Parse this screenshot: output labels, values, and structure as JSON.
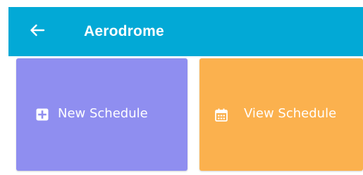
{
  "app_bar": {
    "title": "Aerodrome",
    "back_icon": "arrow-left-icon",
    "background_color": "#02a9d6"
  },
  "actions": [
    {
      "label": "New Schedule",
      "icon": "plus-square-icon",
      "color": "#8f8ef0"
    },
    {
      "label": "View Schedule",
      "icon": "calendar-icon",
      "color": "#fbb14e"
    }
  ]
}
